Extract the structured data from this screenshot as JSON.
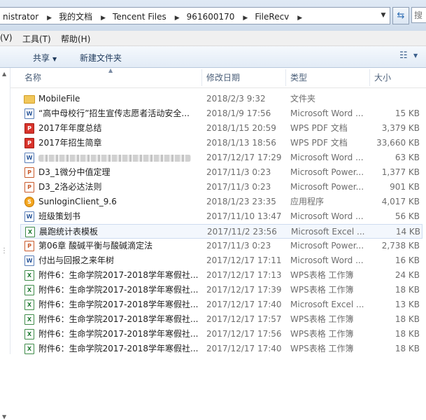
{
  "address_bar": {
    "crumbs": [
      "nistrator",
      "我的文档",
      "Tencent Files",
      "961600170",
      "FileRecv"
    ],
    "search_hint": "搜"
  },
  "menu": [
    "(V)",
    "工具(T)",
    "帮助(H)"
  ],
  "toolbar": {
    "share_label": "共享",
    "new_folder_label": "新建文件夹"
  },
  "columns": {
    "name": "名称",
    "date": "修改日期",
    "type": "类型",
    "size": "大小"
  },
  "files": [
    {
      "icon": "folder-icon",
      "name": "MobileFile",
      "date": "2018/2/3 9:32",
      "type": "文件夹",
      "size": ""
    },
    {
      "icon": "word-doc-icon",
      "name": "“高中母校行”招生宣传志愿者活动安全...",
      "date": "2018/1/9 17:56",
      "type": "Microsoft Word ...",
      "size": "15 KB"
    },
    {
      "icon": "pdf-icon",
      "name": "2017年年度总结",
      "date": "2018/1/15 20:59",
      "type": "WPS PDF 文档",
      "size": "3,379 KB"
    },
    {
      "icon": "pdf-icon",
      "name": "2017年招生简章",
      "date": "2018/1/13 18:56",
      "type": "WPS PDF 文档",
      "size": "33,660 KB"
    },
    {
      "icon": "word-doc-icon",
      "name": "",
      "date": "2017/12/17 17:29",
      "type": "Microsoft Word ...",
      "size": "63 KB",
      "blurred": true
    },
    {
      "icon": "powerpoint-icon",
      "name": "D3_1微分中值定理",
      "date": "2017/11/3 0:23",
      "type": "Microsoft Power...",
      "size": "1,377 KB"
    },
    {
      "icon": "powerpoint-icon",
      "name": "D3_2洛必达法则",
      "date": "2017/11/3 0:23",
      "type": "Microsoft Power...",
      "size": "901 KB"
    },
    {
      "icon": "application-icon",
      "name": "SunloginClient_9.6",
      "date": "2018/1/23 23:35",
      "type": "应用程序",
      "size": "4,017 KB"
    },
    {
      "icon": "word-doc-icon",
      "name": "班级策划书",
      "date": "2017/11/10 13:47",
      "type": "Microsoft Word ...",
      "size": "56 KB"
    },
    {
      "icon": "excel-icon",
      "name": "晨跑统计表模板",
      "date": "2017/11/2 23:56",
      "type": "Microsoft Excel ...",
      "size": "14 KB",
      "selected": true
    },
    {
      "icon": "powerpoint-icon",
      "name": "第06章 酸碱平衡与酸碱滴定法",
      "date": "2017/11/3 0:23",
      "type": "Microsoft Power...",
      "size": "2,738 KB"
    },
    {
      "icon": "word-doc-icon",
      "name": "付出与回报之来年树",
      "date": "2017/12/17 17:11",
      "type": "Microsoft Word ...",
      "size": "16 KB"
    },
    {
      "icon": "excel-icon",
      "name": "附件6：生命学院2017-2018学年寒假社...",
      "date": "2017/12/17 17:13",
      "type": "WPS表格 工作簿",
      "size": "24 KB"
    },
    {
      "icon": "excel-icon",
      "name": "附件6：生命学院2017-2018学年寒假社...",
      "date": "2017/12/17 17:39",
      "type": "WPS表格 工作簿",
      "size": "18 KB"
    },
    {
      "icon": "excel-icon",
      "name": "附件6：生命学院2017-2018学年寒假社...",
      "date": "2017/12/17 17:40",
      "type": "Microsoft Excel ...",
      "size": "13 KB"
    },
    {
      "icon": "excel-icon",
      "name": "附件6：生命学院2017-2018学年寒假社...",
      "date": "2017/12/17 17:57",
      "type": "WPS表格 工作簿",
      "size": "18 KB"
    },
    {
      "icon": "excel-icon",
      "name": "附件6：生命学院2017-2018学年寒假社...",
      "date": "2017/12/17 17:56",
      "type": "WPS表格 工作簿",
      "size": "18 KB"
    },
    {
      "icon": "excel-icon",
      "name": "附件6：生命学院2017-2018学年寒假社...",
      "date": "2017/12/17 17:40",
      "type": "WPS表格 工作簿",
      "size": "18 KB"
    }
  ]
}
